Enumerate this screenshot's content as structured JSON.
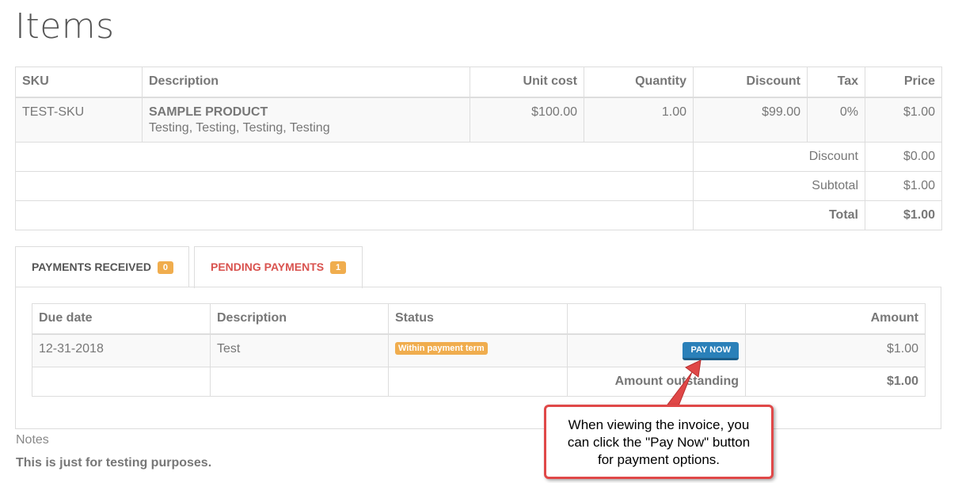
{
  "page": {
    "title": "Items"
  },
  "items_table": {
    "headers": {
      "sku": "SKU",
      "description": "Description",
      "unit_cost": "Unit cost",
      "quantity": "Quantity",
      "discount": "Discount",
      "tax": "Tax",
      "price": "Price"
    },
    "rows": [
      {
        "sku": "TEST-SKU",
        "name": "SAMPLE PRODUCT",
        "description": "Testing, Testing, Testing, Testing",
        "unit_cost": "$100.00",
        "quantity": "1.00",
        "discount": "$99.00",
        "tax": "0%",
        "price": "$1.00"
      }
    ],
    "totals": {
      "discount_label": "Discount",
      "discount_value": "$0.00",
      "subtotal_label": "Subtotal",
      "subtotal_value": "$1.00",
      "total_label": "Total",
      "total_value": "$1.00"
    }
  },
  "tabs": {
    "received": {
      "label": "PAYMENTS RECEIVED",
      "count": "0"
    },
    "pending": {
      "label": "PENDING PAYMENTS",
      "count": "1"
    }
  },
  "payments_table": {
    "headers": {
      "due_date": "Due date",
      "description": "Description",
      "status": "Status",
      "action": "",
      "amount": "Amount"
    },
    "rows": [
      {
        "due_date": "12-31-2018",
        "description": "Test",
        "status": "Within payment term",
        "action": "PAY NOW",
        "amount": "$1.00"
      }
    ],
    "outstanding_label": "Amount outstanding",
    "outstanding_value": "$1.00"
  },
  "notes": {
    "label": "Notes",
    "text": "This is just for testing purposes."
  },
  "callout": {
    "line1": "When viewing the invoice, you",
    "line2": "can click the \"Pay Now\" button",
    "line3": "for payment options."
  },
  "colors": {
    "badge": "#f0ad4e",
    "pending_tab": "#d9534f",
    "pay_button": "#2a80b9",
    "callout_border": "#e04848"
  }
}
